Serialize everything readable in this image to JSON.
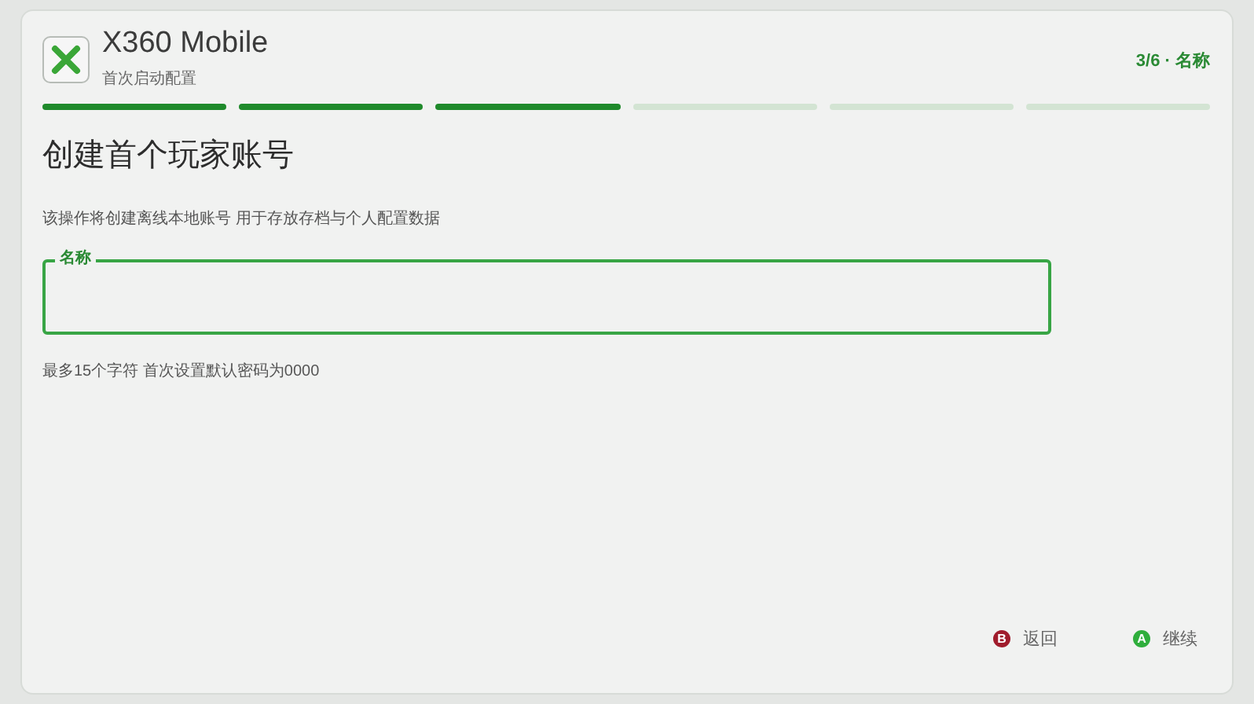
{
  "header": {
    "title": "X360 Mobile",
    "subtitle": "首次启动配置",
    "step": "3/6 · 名称"
  },
  "progress": [
    {
      "done": true
    },
    {
      "done": true
    },
    {
      "done": true
    },
    {
      "done": false
    },
    {
      "done": false
    },
    {
      "done": false
    }
  ],
  "heading": "创建首个玩家账号",
  "description": "该操作将创建离线本地账号 用于存放存档与个人配置数据",
  "field": {
    "label": "名称"
  },
  "hint": "最多15个字符 首次设置默认密码为0000",
  "actions": [
    {
      "key": "B",
      "label": "返回",
      "color": "#a01c2c"
    },
    {
      "key": "A",
      "label": "继续",
      "color": "#2fae3c"
    }
  ]
}
